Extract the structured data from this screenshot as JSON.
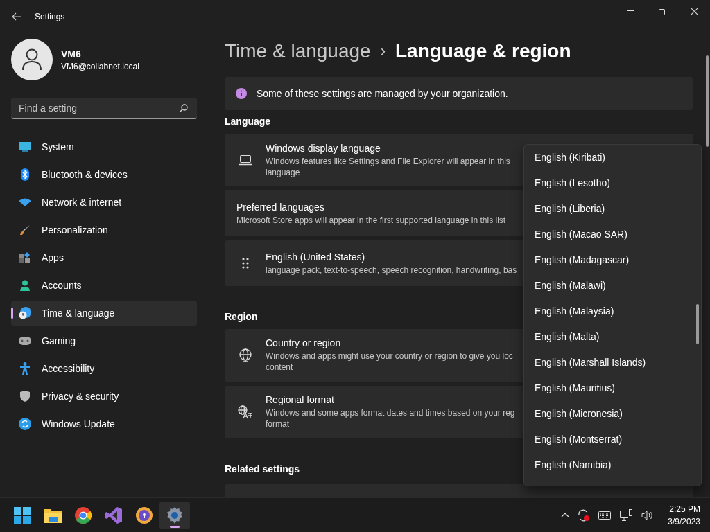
{
  "window": {
    "title": "Settings"
  },
  "user": {
    "name": "VM6",
    "email": "VM6@collabnet.local"
  },
  "search": {
    "placeholder": "Find a setting"
  },
  "sidebar": {
    "items": [
      {
        "label": "System",
        "selected": false
      },
      {
        "label": "Bluetooth & devices",
        "selected": false
      },
      {
        "label": "Network & internet",
        "selected": false
      },
      {
        "label": "Personalization",
        "selected": false
      },
      {
        "label": "Apps",
        "selected": false
      },
      {
        "label": "Accounts",
        "selected": false
      },
      {
        "label": "Time & language",
        "selected": true
      },
      {
        "label": "Gaming",
        "selected": false
      },
      {
        "label": "Accessibility",
        "selected": false
      },
      {
        "label": "Privacy & security",
        "selected": false
      },
      {
        "label": "Windows Update",
        "selected": false
      }
    ]
  },
  "breadcrumb": {
    "parent": "Time & language",
    "separator": "›",
    "current": "Language & region"
  },
  "banner": {
    "text": "Some of these settings are managed by your organization."
  },
  "sections": [
    {
      "title": "Language",
      "cards": [
        {
          "title": "Windows display language",
          "description": "Windows features like Settings and File Explorer will appear in this language"
        },
        {
          "title": "Preferred languages",
          "description": "Microsoft Store apps will appear in the first supported language in this list"
        },
        {
          "title": "English (United States)",
          "description": "language pack, text-to-speech, speech recognition, handwriting, bas"
        }
      ]
    },
    {
      "title": "Region",
      "cards": [
        {
          "title": "Country or region",
          "description": "Windows and apps might use your country or region to give you loc content"
        },
        {
          "title": "Regional format",
          "description": "Windows and some apps format dates and times based on your reg format"
        }
      ]
    },
    {
      "title": "Related settings"
    }
  ],
  "dropdown": {
    "items": [
      {
        "label": "English (Kiribati)",
        "selected": false
      },
      {
        "label": "English (Lesotho)",
        "selected": false
      },
      {
        "label": "English (Liberia)",
        "selected": false
      },
      {
        "label": "English (Macao SAR)",
        "selected": false
      },
      {
        "label": "English (Madagascar)",
        "selected": false
      },
      {
        "label": "English (Malawi)",
        "selected": false
      },
      {
        "label": "English (Malaysia)",
        "selected": false
      },
      {
        "label": "English (Malta)",
        "selected": false
      },
      {
        "label": "English (Marshall Islands)",
        "selected": false
      },
      {
        "label": "English (Mauritius)",
        "selected": false
      },
      {
        "label": "English (Micronesia)",
        "selected": false
      },
      {
        "label": "English (Montserrat)",
        "selected": false
      },
      {
        "label": "English (Namibia)",
        "selected": false
      }
    ]
  },
  "taskbar": {
    "apps": [
      {
        "active": false
      },
      {
        "active": false
      },
      {
        "active": false
      },
      {
        "active": false
      },
      {
        "active": false
      },
      {
        "active": true
      }
    ],
    "time": "2:25 PM",
    "date": "3/9/2023"
  }
}
